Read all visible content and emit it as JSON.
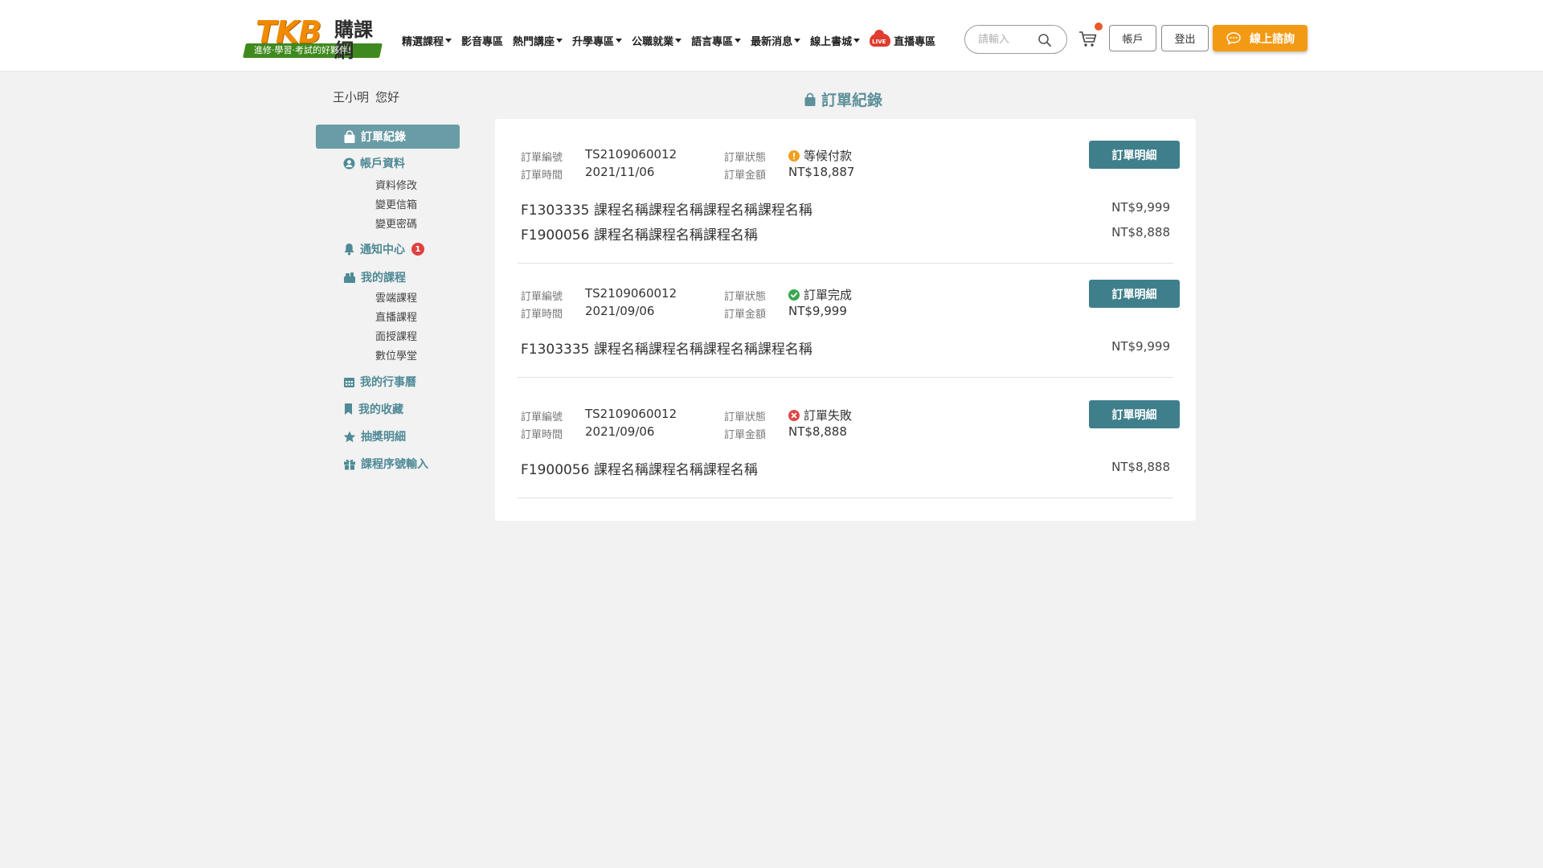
{
  "header": {
    "logo": {
      "main": "TKB",
      "side": "購課網",
      "slogan": "進修·學習·考試的好夥伴!"
    },
    "nav": [
      {
        "label": "精選課程",
        "dropdown": true
      },
      {
        "label": "影音專區",
        "dropdown": false
      },
      {
        "label": "熱門講座",
        "dropdown": true
      },
      {
        "label": "升學專區",
        "dropdown": true
      },
      {
        "label": "公職就業",
        "dropdown": true
      },
      {
        "label": "語言專區",
        "dropdown": true
      },
      {
        "label": "最新消息",
        "dropdown": true
      },
      {
        "label": "線上書城",
        "dropdown": true
      }
    ],
    "live": {
      "badge": "LIVE",
      "label": "直播專區"
    },
    "search": {
      "placeholder": "請輸入"
    },
    "account_label": "帳戶",
    "logout_label": "登出",
    "consult_label": "線上諮詢",
    "colors": {
      "accent": "#f39a14",
      "cart_dot": "#e85a2c"
    }
  },
  "sidebar": {
    "greeting_name": "王小明",
    "greeting_suffix": "您好",
    "active_label": "訂單紀錄",
    "account": {
      "label": "帳戶資料",
      "subs": [
        "資料修改",
        "變更信箱",
        "變更密碼"
      ]
    },
    "notification": {
      "label": "通知中心",
      "badge": "1"
    },
    "courses": {
      "label": "我的課程",
      "subs": [
        "雲端課程",
        "直播課程",
        "面授課程",
        "數位學堂"
      ]
    },
    "calendar_label": "我的行事曆",
    "favorites_label": "我的收藏",
    "lottery_label": "抽獎明細",
    "serial_label": "課程序號輸入",
    "colors": {
      "active_bg": "#6a9ca6",
      "link": "#4f8a96"
    }
  },
  "main": {
    "title": "訂單紀錄",
    "labels": {
      "order_no": "訂單編號",
      "order_time": "訂單時間",
      "status": "訂單狀態",
      "amount": "訂單金額",
      "detail_button": "訂單明細"
    },
    "orders": [
      {
        "order_no": "TS2109060012",
        "order_time": "2021/11/06",
        "status": "等候付款",
        "status_type": "pending",
        "amount": "NT$18,887",
        "items": [
          {
            "name": "F1303335 課程名稱課程名稱課程名稱課程名稱",
            "price": "NT$9,999"
          },
          {
            "name": "F1900056 課程名稱課程名稱課程名稱",
            "price": "NT$8,888"
          }
        ]
      },
      {
        "order_no": "TS2109060012",
        "order_time": "2021/09/06",
        "status": "訂單完成",
        "status_type": "complete",
        "amount": "NT$9,999",
        "items": [
          {
            "name": "F1303335 課程名稱課程名稱課程名稱課程名稱",
            "price": "NT$9,999"
          }
        ]
      },
      {
        "order_no": "TS2109060012",
        "order_time": "2021/09/06",
        "status": "訂單失敗",
        "status_type": "failed",
        "amount": "NT$8,888",
        "items": [
          {
            "name": "F1900056 課程名稱課程名稱課程名稱",
            "price": "NT$8,888"
          }
        ]
      }
    ],
    "colors": {
      "title": "#5d909b",
      "detail_button": "#3f7f8c",
      "pending": "#f0a020",
      "complete": "#3aa84f",
      "failed": "#e04848"
    }
  }
}
